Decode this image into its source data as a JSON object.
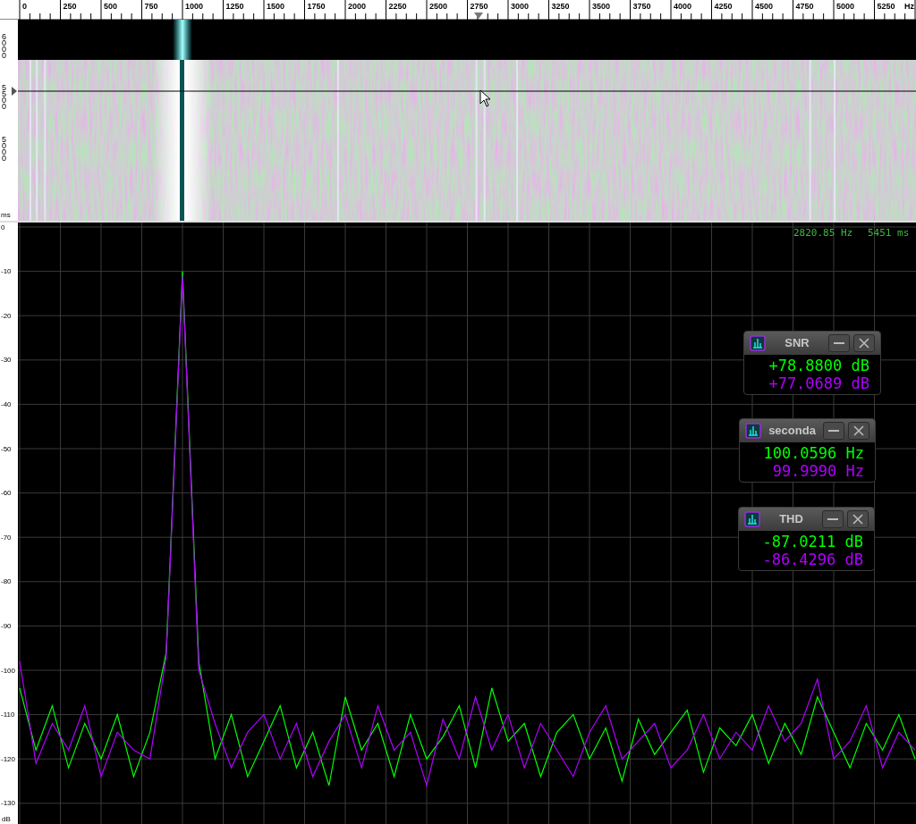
{
  "frequency_ruler": {
    "ticks": [
      "0",
      "250",
      "500",
      "750",
      "1000",
      "1250",
      "1500",
      "1750",
      "2000",
      "2250",
      "2500",
      "2750",
      "3000",
      "3250",
      "3500",
      "3750",
      "4000",
      "4250",
      "4500",
      "4750",
      "5000",
      "5250"
    ],
    "unit": "Hz"
  },
  "spectrogram": {
    "time_labels": [
      "6000",
      "5500",
      "5000"
    ],
    "unit": "ms"
  },
  "cursor_readout": {
    "frequency": "2820.85 Hz",
    "time": "5451 ms"
  },
  "spectrum": {
    "unit": "dB",
    "chart_data": {
      "type": "line",
      "categories": [
        null,
        null,
        null,
        null,
        null,
        null,
        null,
        null,
        null,
        null,
        null,
        null,
        null,
        null,
        null,
        null,
        null,
        null,
        null,
        null,
        null,
        null,
        null,
        null,
        null,
        null,
        null,
        null,
        null,
        null,
        null,
        null,
        null,
        null,
        null,
        null,
        null,
        null,
        null,
        null,
        null,
        null,
        null,
        null,
        null,
        null,
        null,
        null,
        null,
        null,
        null,
        null,
        null,
        null,
        null,
        null
      ],
      "series": [
        {
          "color": "#00ff00",
          "values": [
            -104,
            -118,
            -108,
            -122,
            -112,
            -120,
            -110,
            -124,
            -114,
            -96,
            -10,
            -98,
            -120,
            -110,
            -124,
            -116,
            -108,
            -122,
            -114,
            -126,
            -106,
            -118,
            -112,
            -124,
            -110,
            -120,
            -115,
            -108,
            -122,
            -104,
            -116,
            -112,
            -124,
            -114,
            -110,
            -120,
            -113,
            -125,
            -111,
            -119,
            -114,
            -109,
            -123,
            -113,
            -117,
            -110,
            -121,
            -112,
            -119,
            -106,
            -114,
            -122,
            -112,
            -118,
            -110,
            -120
          ]
        },
        {
          "color": "#b000ff",
          "values": [
            -98,
            -121,
            -112,
            -118,
            -108,
            -124,
            -114,
            -118,
            -120,
            -97,
            -11,
            -100,
            -112,
            -122,
            -114,
            -110,
            -120,
            -112,
            -124,
            -116,
            -110,
            -122,
            -108,
            -118,
            -114,
            -126,
            -111,
            -120,
            -106,
            -118,
            -110,
            -122,
            -112,
            -118,
            -124,
            -114,
            -108,
            -120,
            -116,
            -112,
            -122,
            -118,
            -110,
            -120,
            -114,
            -118,
            -108,
            -116,
            -112,
            -102,
            -120,
            -116,
            -108,
            -122,
            -114,
            -118
          ]
        }
      ],
      "grid": true,
      "ylim": [
        -135,
        0
      ],
      "yticks": [
        {
          "value": 0,
          "label": "0"
        },
        {
          "value": -10,
          "label": "-10"
        },
        {
          "value": -20,
          "label": "-20"
        },
        {
          "value": -30,
          "label": "-30"
        },
        {
          "value": -40,
          "label": "-40"
        },
        {
          "value": -50,
          "label": "-50"
        },
        {
          "value": -60,
          "label": "-60"
        },
        {
          "value": -70,
          "label": "-70"
        },
        {
          "value": -80,
          "label": "-80"
        },
        {
          "value": -90,
          "label": "-90"
        },
        {
          "value": -100,
          "label": "-100"
        },
        {
          "value": -110,
          "label": "-110"
        },
        {
          "value": -120,
          "label": "-120"
        },
        {
          "value": -130,
          "label": "-130"
        }
      ]
    }
  },
  "meters": [
    {
      "title": "SNR",
      "values": [
        {
          "text": "+78.8800 dB",
          "color": "#00ff00"
        },
        {
          "text": "+77.0689 dB",
          "color": "#b000ff"
        }
      ]
    },
    {
      "title": "seconda",
      "values": [
        {
          "text": "100.0596 Hz",
          "color": "#00ff00"
        },
        {
          "text": "99.9990 Hz",
          "color": "#b000ff"
        }
      ]
    },
    {
      "title": "THD",
      "values": [
        {
          "text": "-87.0211 dB",
          "color": "#00ff00"
        },
        {
          "text": "-86.4296 dB",
          "color": "#b000ff"
        }
      ]
    }
  ]
}
